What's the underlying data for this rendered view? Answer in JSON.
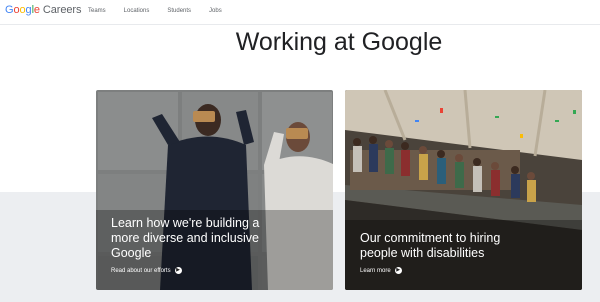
{
  "header": {
    "logo_google": "Google",
    "logo_careers": "Careers",
    "nav": [
      {
        "label": "Teams"
      },
      {
        "label": "Locations"
      },
      {
        "label": "Students"
      },
      {
        "label": "Jobs"
      }
    ]
  },
  "main": {
    "title": "Working at Google",
    "cards": [
      {
        "headline": "Learn how we're building a more diverse and inclusive Google",
        "link": "Read about our efforts"
      },
      {
        "headline": "Our commitment to hiring people with disabilities",
        "link": "Learn more"
      }
    ]
  },
  "colors": {
    "google_blue": "#4285f4",
    "google_red": "#ea4335",
    "google_yellow": "#fbbc05",
    "google_green": "#34a853",
    "band": "#eceef1"
  }
}
